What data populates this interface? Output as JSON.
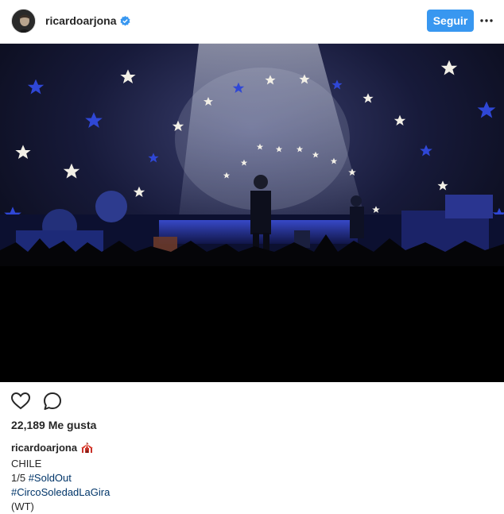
{
  "header": {
    "username": "ricardoarjona",
    "verified": true,
    "follow_label": "Seguir",
    "more_icon": "ellipsis-icon"
  },
  "actions": {
    "like_icon": "heart-icon",
    "comment_icon": "comment-bubble-icon"
  },
  "likes": {
    "text": "22,189 Me gusta"
  },
  "caption": {
    "username": "ricardoarjona",
    "emoji": "circus-tent-emoji",
    "line1": "CHILE",
    "line2_prefix": "1/5 ",
    "hashtag1": "#SoldOut",
    "hashtag2": "#CircoSoledadLaGira",
    "signature": "(WT)"
  },
  "colors": {
    "follow_button": "#3897f0",
    "hashtag": "#003569",
    "text": "#262626"
  }
}
